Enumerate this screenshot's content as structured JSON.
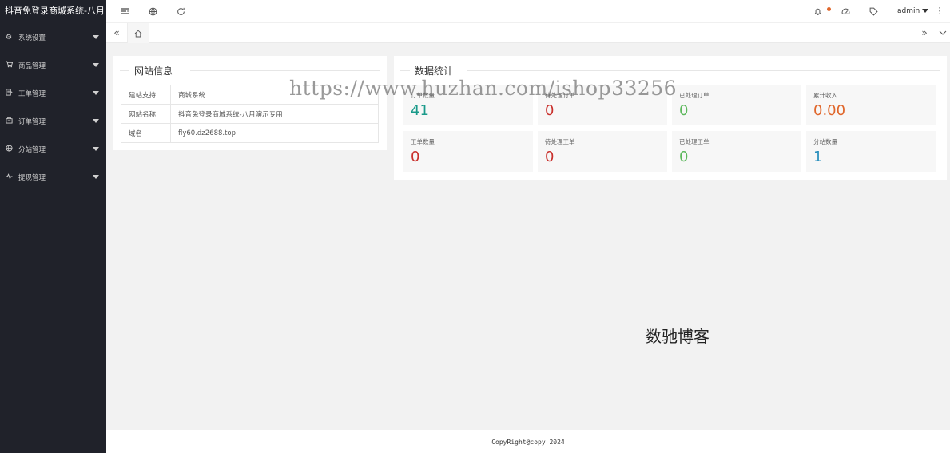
{
  "app": {
    "title": "抖音免登录商城系统-八月"
  },
  "sidebar": {
    "items": [
      {
        "label": "系统设置",
        "icon": "gear-icon"
      },
      {
        "label": "商品管理",
        "icon": "cart-icon"
      },
      {
        "label": "工单管理",
        "icon": "ticket-icon"
      },
      {
        "label": "订单管理",
        "icon": "order-icon"
      },
      {
        "label": "分站管理",
        "icon": "globe-icon"
      },
      {
        "label": "提现管理",
        "icon": "pulse-icon"
      }
    ]
  },
  "header": {
    "user": "admin"
  },
  "website_info": {
    "title": "网站信息",
    "rows": [
      {
        "key": "建站支持",
        "value": "商城系统"
      },
      {
        "key": "网站名称",
        "value": "抖音免登录商城系统-八月演示专用"
      },
      {
        "key": "域名",
        "value": "fly60.dz2688.top"
      }
    ]
  },
  "stats": {
    "title": "数据统计",
    "items": [
      {
        "label": "订单数量",
        "value": "41",
        "color": "#1a9a8a"
      },
      {
        "label": "待处理订单",
        "value": "0",
        "color": "#c9302c"
      },
      {
        "label": "已处理订单",
        "value": "0",
        "color": "#5cb85c"
      },
      {
        "label": "累计收入",
        "value": "0.00",
        "color": "#e0662a"
      },
      {
        "label": "工单数量",
        "value": "0",
        "color": "#c9302c"
      },
      {
        "label": "待处理工单",
        "value": "0",
        "color": "#c9302c"
      },
      {
        "label": "已处理工单",
        "value": "0",
        "color": "#5cb85c"
      },
      {
        "label": "分站数量",
        "value": "1",
        "color": "#2a8fbd"
      }
    ]
  },
  "watermark": "https://www.huzhan.com/ishop33256",
  "center_text": "数驰博客",
  "footer": "CopyRight@copy 2024"
}
